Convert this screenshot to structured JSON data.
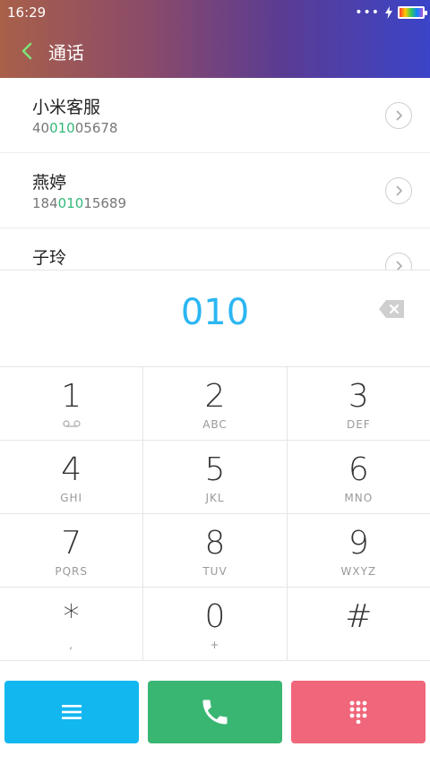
{
  "status": {
    "time": "16:29",
    "dots": "•••"
  },
  "header": {
    "title": "通话"
  },
  "results": [
    {
      "name": "小米客服",
      "number_prefix": "40",
      "number_match": "010",
      "number_suffix": "05678"
    },
    {
      "name": "燕婷",
      "number_prefix": "184",
      "number_match": "010",
      "number_suffix": "15689"
    },
    {
      "name": "子玲",
      "number_prefix": "",
      "number_match": "",
      "number_suffix": ""
    }
  ],
  "dialer": {
    "input": "010"
  },
  "keypad": {
    "rows": [
      [
        {
          "digit": "1",
          "letters": ""
        },
        {
          "digit": "2",
          "letters": "ABC"
        },
        {
          "digit": "3",
          "letters": "DEF"
        }
      ],
      [
        {
          "digit": "4",
          "letters": "GHI"
        },
        {
          "digit": "5",
          "letters": "JKL"
        },
        {
          "digit": "6",
          "letters": "MNO"
        }
      ],
      [
        {
          "digit": "7",
          "letters": "PQRS"
        },
        {
          "digit": "8",
          "letters": "TUV"
        },
        {
          "digit": "9",
          "letters": "WXYZ"
        }
      ],
      [
        {
          "digit": "*",
          "letters": ","
        },
        {
          "digit": "0",
          "letters": "+"
        },
        {
          "digit": "#",
          "letters": ""
        }
      ]
    ]
  },
  "colors": {
    "match": "#33b87a",
    "input": "#2bb6f2",
    "menu": "#13b7f0",
    "call": "#3ab673",
    "pad": "#f0667a"
  },
  "icons": {
    "back": "chevron-left-icon",
    "detail": "chevron-right-circle-icon",
    "backspace": "backspace-icon",
    "voicemail": "voicemail-icon",
    "menu": "menu-icon",
    "call": "phone-icon",
    "pad": "dialpad-icon"
  }
}
